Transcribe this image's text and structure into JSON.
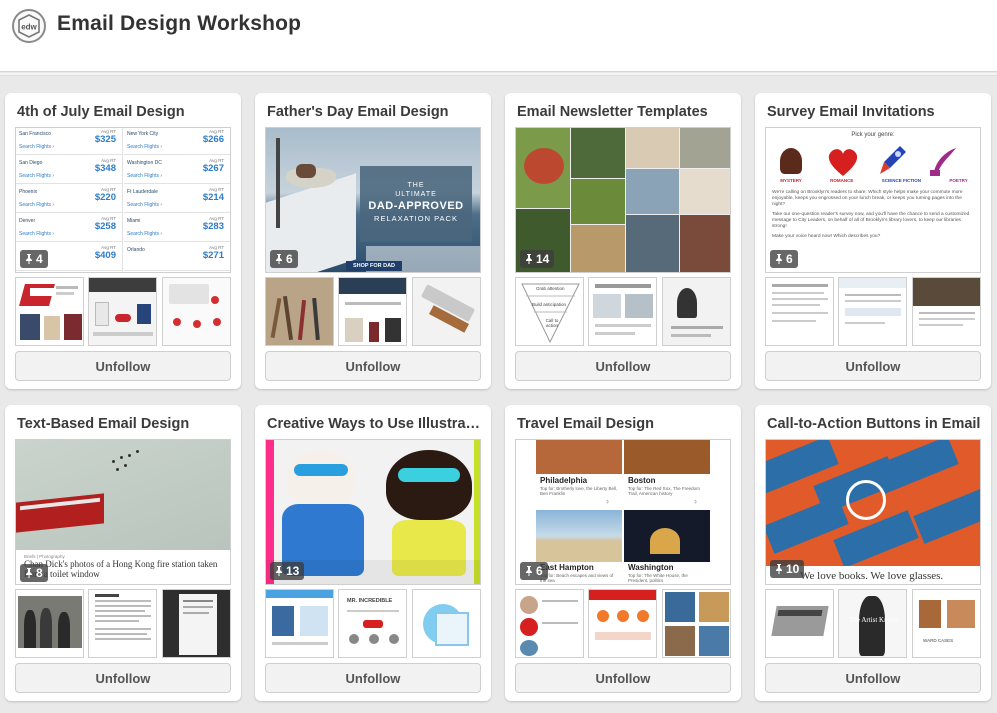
{
  "header": {
    "logo_text": "edw",
    "title": "Email Design Workshop"
  },
  "boards": [
    {
      "title": "4th of July Email Design",
      "pin_count": "4",
      "unfollow_label": "Unfollow",
      "flights": [
        {
          "city": "San Francisco",
          "dates": "Week of June 6",
          "avg": "Avg RT",
          "price": "$325",
          "link": "Search Flights ›"
        },
        {
          "city": "New York City",
          "dates": "Week of June 13",
          "avg": "Avg RT",
          "price": "$266",
          "link": "Search Flights ›"
        },
        {
          "city": "San Diego",
          "dates": "Week of June 6",
          "avg": "Avg RT",
          "price": "$348",
          "link": "Search Flights ›"
        },
        {
          "city": "Washington DC",
          "dates": "Week of June 13",
          "avg": "Avg RT",
          "price": "$267",
          "link": "Search Flights ›"
        },
        {
          "city": "Phoenix",
          "dates": "Week of June 20",
          "avg": "Avg RT",
          "price": "$220",
          "link": "Search Flights ›"
        },
        {
          "city": "Ft Lauderdale",
          "dates": "Week of June 13",
          "avg": "Avg RT",
          "price": "$214",
          "link": "Search Flights ›"
        },
        {
          "city": "Denver",
          "dates": "Week of June 13",
          "avg": "Avg RT",
          "price": "$258",
          "link": "Search Flights ›"
        },
        {
          "city": "Miami",
          "dates": "Week of June 6",
          "avg": "Avg RT",
          "price": "$283",
          "link": "Search Flights ›"
        },
        {
          "city": "",
          "dates": "Week of June 13",
          "avg": "Avg RT",
          "price": "$409",
          "link": ""
        },
        {
          "city": "Orlando",
          "dates": "Week of June 6",
          "avg": "Avg RT",
          "price": "$271",
          "link": ""
        }
      ]
    },
    {
      "title": "Father's Day Email Design",
      "pin_count": "6",
      "unfollow_label": "Unfollow",
      "banner": {
        "line1": "THE",
        "line2": "ULTIMATE",
        "line3": "DAD-APPROVED",
        "line4": "RELAXATION PACK",
        "cta": "SHOP FOR DAD"
      }
    },
    {
      "title": "Email Newsletter Templates",
      "pin_count": "14",
      "unfollow_label": "Unfollow",
      "thumb_text": {
        "grab": "Grab attention",
        "build": "Build anticipation",
        "cta": "Call to action"
      }
    },
    {
      "title": "Survey Email Invitations",
      "pin_count": "6",
      "unfollow_label": "Unfollow",
      "survey": {
        "heading": "Pick your genre:",
        "genres": [
          "MYSTERY",
          "ROMANCE",
          "SCIENCE FICTION",
          "POETRY"
        ],
        "p1": "We're calling on Brooklyn's readers to share: Which style helps make your commute more enjoyable, keeps you engrossed on your lunch break, or keeps you turning pages into the night?",
        "p2": "Take our one-question reader's survey now, and you'll have the chance to send a customized message to City Leaders, on behalf of all of Brooklyn's library lovers, to keep our libraries strong!",
        "p3": "Make your voice heard now! Which describes you?"
      }
    },
    {
      "title": "Text-Based Email Design",
      "pin_count": "8",
      "unfollow_label": "Unfollow",
      "caption_byline": "Briefs | Photography",
      "caption": "Chan Dick's photos of a Hong Kong fire station taken from a toilet window"
    },
    {
      "title": "Creative Ways to Use Illustrat...",
      "pin_count": "13",
      "unfollow_label": "Unfollow",
      "thumb_text": {
        "mr": "MR. INCREDIBLE"
      }
    },
    {
      "title": "Travel Email Design",
      "pin_count": "6",
      "unfollow_label": "Unfollow",
      "cities": [
        {
          "name": "Philadelphia",
          "desc": "Top for: Brotherly love, the Liberty Bell, Ben Franklin"
        },
        {
          "name": "Boston",
          "desc": "Top for: The Red Sox, The Freedom Trail, American history"
        },
        {
          "name": "East Hampton",
          "desc": "Top for: Beach escapes and views of the sea"
        },
        {
          "name": "Washington",
          "desc": "Top for: The White House, the President, politics"
        }
      ]
    },
    {
      "title": "Call-to-Action Buttons in Email",
      "pin_count": "10",
      "unfollow_label": "Unfollow",
      "caption": "We love books. We love glasses.",
      "thumb_text": {
        "artist": "The Artist Knows",
        "label": "WARD CASES"
      }
    }
  ],
  "colors": {
    "page_bg": "#e9e9e9",
    "card_bg": "#ffffff",
    "title_text": "#333333",
    "button_bg": "#f2f2f2",
    "badge_bg": "#3c3c3c"
  }
}
